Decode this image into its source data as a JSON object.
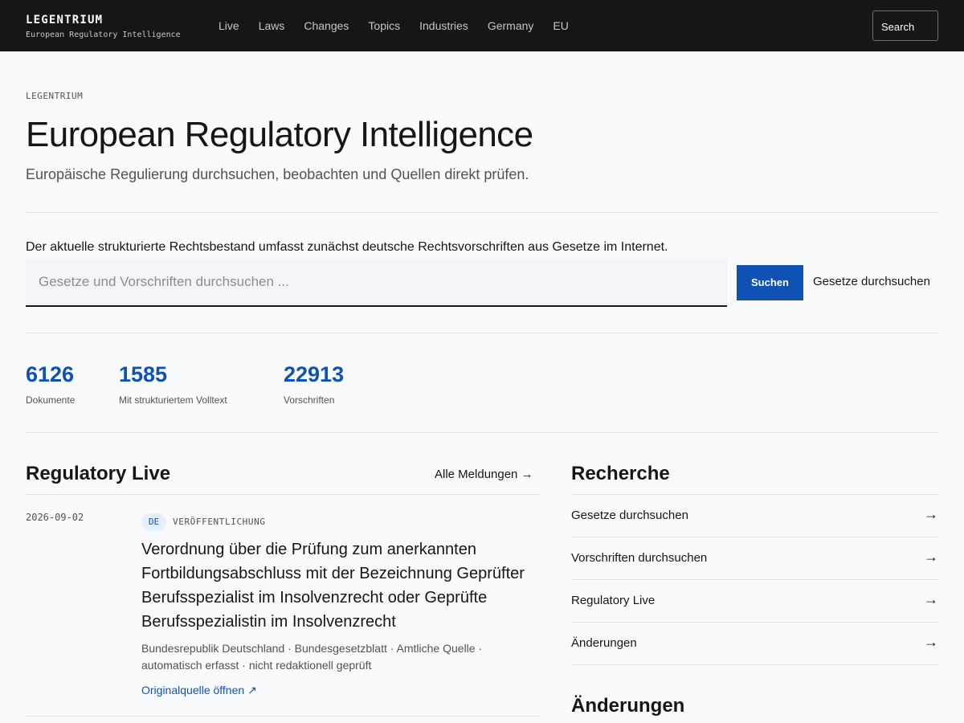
{
  "brand": {
    "name": "LEGENTRIUM",
    "tagline": "European Regulatory Intelligence"
  },
  "nav": [
    "Live",
    "Laws",
    "Changes",
    "Topics",
    "Industries",
    "Germany",
    "EU"
  ],
  "top_search_label": "Search",
  "hero": {
    "eyebrow": "LEGENTRIUM",
    "title": "European Regulatory Intelligence",
    "subtitle": "Europäische Regulierung durchsuchen, beobachten und Quellen direkt prüfen."
  },
  "search": {
    "intro": "Der aktuelle strukturierte Rechtsbestand umfasst zunächst deutsche Rechtsvorschriften aus Gesetze im Internet.",
    "placeholder": "Gesetze und Vorschriften durchsuchen ...",
    "button": "Suchen",
    "browse_link": "Gesetze durchsuchen"
  },
  "stats": [
    {
      "value": "6126",
      "label": "Dokumente"
    },
    {
      "value": "1585",
      "label": "Mit strukturiertem Volltext"
    },
    {
      "value": "22913",
      "label": "Vorschriften"
    }
  ],
  "live": {
    "title": "Regulatory Live",
    "all_link": "Alle Meldungen",
    "arrow": "→",
    "item": {
      "date": "2026-09-02",
      "badge": "DE",
      "type": "VERÖFFENTLICHUNG",
      "title": "Verordnung über die Prüfung zum anerkannten Fortbildungsabschluss mit der Bezeichnung Geprüfter Berufsspezialist im Insolvenzrecht oder Geprüfte Berufsspezialistin im Insolvenzrecht",
      "meta": "Bundesrepublik Deutschland · Bundesgesetzblatt · Amtliche Quelle · automatisch erfasst · nicht redaktionell geprüft",
      "source_link": "Originalquelle öffnen",
      "source_icon": "↗"
    }
  },
  "research": {
    "title": "Recherche",
    "arrow": "→",
    "items": [
      "Gesetze durchsuchen",
      "Vorschriften durchsuchen",
      "Regulatory Live",
      "Änderungen"
    ]
  },
  "changes": {
    "title": "Änderungen"
  },
  "colors": {
    "topbar": "#161616",
    "accent": "#0f52b3",
    "badge_bg": "#e5efff"
  }
}
